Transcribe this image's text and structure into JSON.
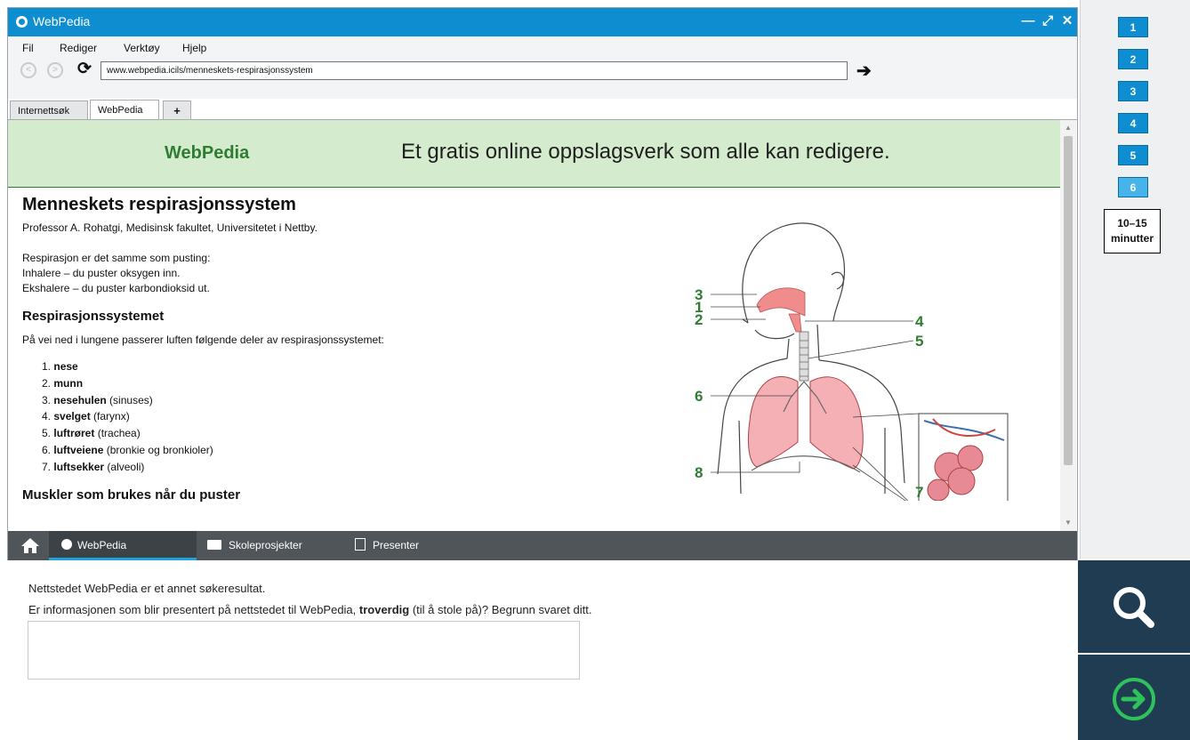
{
  "window": {
    "title": "WebPedia"
  },
  "menu": [
    "Fil",
    "Rediger",
    "Verktøy",
    "Hjelp"
  ],
  "address": {
    "url": "www.webpedia.icils/menneskets-respirasjonssystem"
  },
  "tabs": [
    {
      "label": "Internettsøk"
    },
    {
      "label": "WebPedia"
    },
    {
      "label": "+"
    }
  ],
  "banner": {
    "brand": "WebPedia",
    "slogan": "Et gratis online oppslagsverk som alle kan redigere."
  },
  "article": {
    "title": "Menneskets respirasjonssystem",
    "author": "Professor A. Rohatgi, Medisinsk fakultet, Universitetet i Nettby.",
    "intro": [
      "Respirasjon er det samme som pusting:",
      "Inhalere – du puster oksygen inn.",
      "Ekshalere – du puster karbondioksid ut."
    ],
    "section_title": "Respirasjonssystemet",
    "section_text": "På vei ned i lungene passerer luften følgende deler av respirasjonssystemet:",
    "list": [
      {
        "num": "1.",
        "term": "nese",
        "note": ""
      },
      {
        "num": "2.",
        "term": "munn",
        "note": ""
      },
      {
        "num": "3.",
        "term": "nesehulen",
        "note": " (sinuses)"
      },
      {
        "num": "4.",
        "term": "svelget",
        "note": " (farynx)"
      },
      {
        "num": "5.",
        "term": "luftrøret",
        "note": " (trachea)"
      },
      {
        "num": "6.",
        "term": "luftveiene",
        "note": " (bronkie og bronkioler)"
      },
      {
        "num": "7.",
        "term": "luftsekker",
        "note": " (alveoli)"
      }
    ],
    "next_heading": "Muskler som brukes når du puster"
  },
  "diagram": {
    "labels": [
      "3",
      "1",
      "2",
      "4",
      "5",
      "6",
      "7",
      "8"
    ],
    "label_color": "#2e7d32",
    "organ_color": "#f08c8c"
  },
  "appbar": {
    "home_icon": "home-icon",
    "items": [
      {
        "label": "WebPedia",
        "icon": "globe-icon"
      },
      {
        "label": "Skoleprosjekter",
        "icon": "folder-icon"
      },
      {
        "label": "Presenter",
        "icon": "presentation-icon"
      }
    ]
  },
  "question": {
    "line1": "Nettstedet WebPedia er et annet søkeresultat.",
    "line2_before": "Er informasjonen som blir presentert på nettstedet til WebPedia, ",
    "line2_bold": "troverdig",
    "line2_after": " (til å stole på)? Begrunn svaret ditt."
  },
  "sidepanel": {
    "questions": [
      "1",
      "2",
      "3",
      "4",
      "5",
      "6"
    ],
    "current": "6",
    "timer_line1": "10–15",
    "timer_line2": "minutter",
    "search_icon": "search-icon",
    "next_icon": "arrow-right-circle-icon"
  },
  "colors": {
    "titlebar": "#0e8ed1",
    "banner_bg": "#d5ebce",
    "brand_green": "#2e7d32",
    "dark_panel": "#1f3c53",
    "next_green": "#2ec25a"
  }
}
